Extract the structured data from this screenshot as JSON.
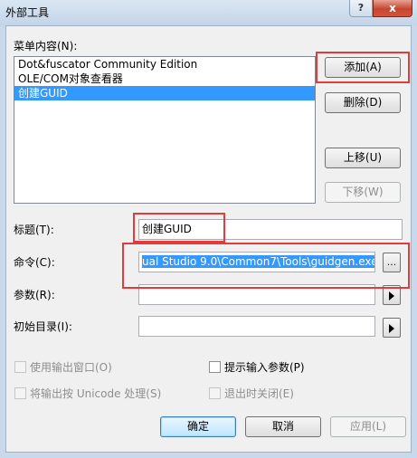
{
  "window": {
    "title": "外部工具",
    "help_label": "?",
    "close_label": "x"
  },
  "menu_contents": {
    "label": "菜单内容(N):",
    "items": [
      {
        "label": "Dot&fuscator Community Edition",
        "selected": false
      },
      {
        "label": "OLE/COM对象查看器",
        "selected": false
      },
      {
        "label": "创建GUID",
        "selected": true
      }
    ]
  },
  "buttons": {
    "add": "添加(A)",
    "delete": "删除(D)",
    "move_up": "上移(U)",
    "move_down": "下移(W)",
    "ok": "确定",
    "cancel": "取消",
    "apply": "应用(L)"
  },
  "fields": {
    "title_label": "标题(T):",
    "title_value": "创建GUID",
    "command_label": "命令(C):",
    "command_value": "ual Studio 9.0\\Common7\\Tools\\guidgen.exe",
    "browse_label": "...",
    "args_label": "参数(R):",
    "args_value": "",
    "initdir_label": "初始目录(I):",
    "initdir_value": ""
  },
  "options": {
    "use_output_window": "使用输出窗口(O)",
    "prompt_for_args": "提示输入参数(P)",
    "treat_unicode": "将输出按 Unicode 处理(S)",
    "close_on_exit": "退出时关闭(E)"
  },
  "colors": {
    "highlight_box": "#e33a3a",
    "selection": "#3399ff"
  }
}
